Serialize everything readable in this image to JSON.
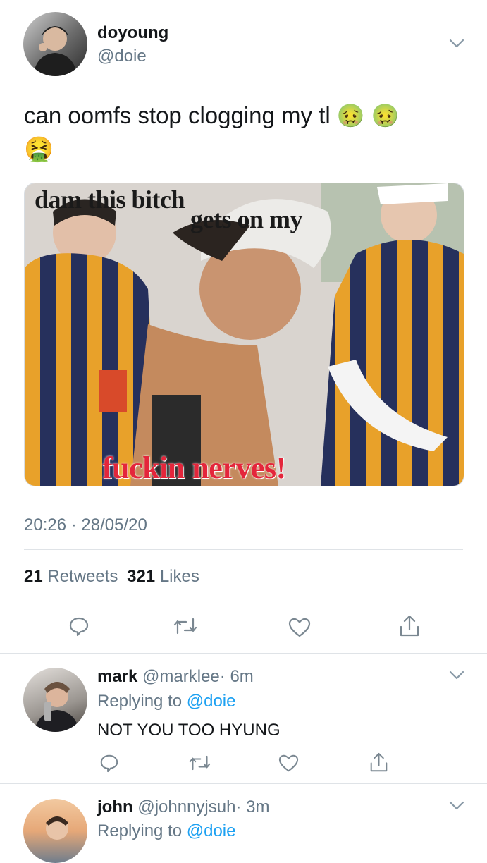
{
  "tweet": {
    "author_name": "doyoung",
    "author_handle": "@doie",
    "text": "can oomfs stop clogging my tl",
    "emoji_line1": "🤢 🤢",
    "emoji_line2": "🤮",
    "media": {
      "caption_top": "dam this bitch",
      "caption_mid": "gets on my",
      "caption_bottom": "fuckin nerves!"
    },
    "timestamp": "20:26 · 28/05/20",
    "retweets_count": "21",
    "retweets_label": "Retweets",
    "likes_count": "321",
    "likes_label": "Likes"
  },
  "replies": [
    {
      "name": "mark",
      "handle": "@marklee",
      "time": "· 6m",
      "replying_label": "Replying to",
      "replying_to": "@doie",
      "text": "NOT YOU TOO HYUNG"
    },
    {
      "name": "john",
      "handle": "@johnnyjsuh",
      "time": "· 3m",
      "replying_label": "Replying to",
      "replying_to": "@doie"
    }
  ],
  "colors": {
    "accent": "#1da1f2",
    "muted": "#657786",
    "icon": "#7a8791",
    "divider": "#dfe3e7"
  }
}
